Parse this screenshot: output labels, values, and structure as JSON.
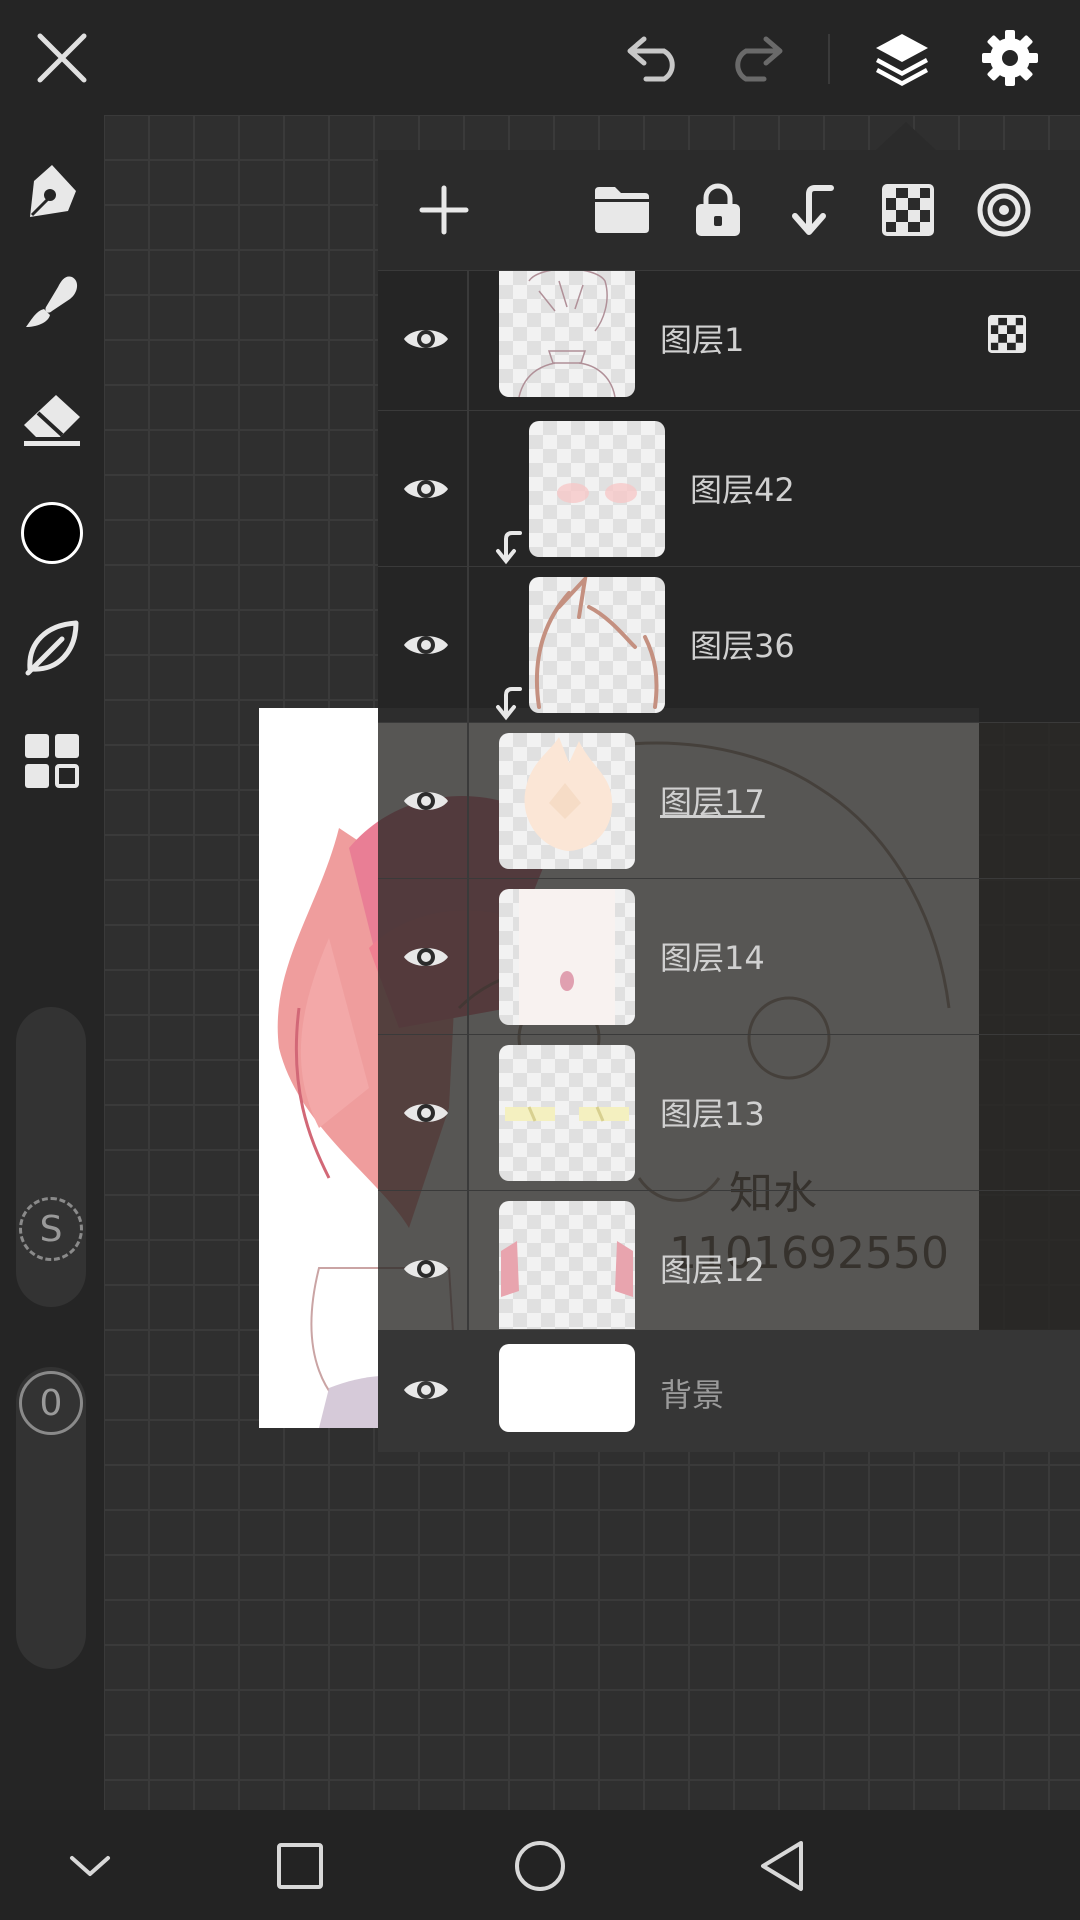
{
  "colors": {
    "current_brush_color": "#000000",
    "toolbar_bg": "#252525",
    "panel_bg": "#2b2b2b",
    "icon": "#e0e0e0"
  },
  "left_toolbar": {
    "slider_size_label": "S",
    "slider_opacity_label": "0"
  },
  "canvas": {
    "watermark_name": "知水",
    "watermark_number": "1101692550"
  },
  "layers": [
    {
      "name": "图层1",
      "visible": true,
      "clipped": false,
      "selected": false,
      "has_alpha_lock_icon": true
    },
    {
      "name": "图层42",
      "visible": true,
      "clipped": true,
      "selected": false
    },
    {
      "name": "图层36",
      "visible": true,
      "clipped": true,
      "selected": false
    },
    {
      "name": "图层17",
      "visible": true,
      "clipped": false,
      "selected": true
    },
    {
      "name": "图层14",
      "visible": true,
      "clipped": false,
      "selected": false
    },
    {
      "name": "图层13",
      "visible": true,
      "clipped": false,
      "selected": false
    },
    {
      "name": "图层12",
      "visible": true,
      "clipped": false,
      "selected": false
    },
    {
      "name": "背景",
      "visible": true,
      "clipped": false,
      "selected": false,
      "background": true
    }
  ],
  "icons": {
    "top": [
      "close-icon",
      "undo-icon",
      "redo-icon",
      "layers-icon",
      "settings-icon"
    ],
    "left": [
      "pen-icon",
      "brush-icon",
      "eraser-icon",
      "color-swatch",
      "leaf-icon",
      "grid-icon"
    ],
    "panel": [
      "add-layer-icon",
      "folder-icon",
      "lock-icon",
      "clip-icon",
      "alpha-lock-icon",
      "blend-icon"
    ],
    "bottom": [
      "chevron-down-icon",
      "recents-icon",
      "home-icon",
      "back-icon"
    ]
  }
}
